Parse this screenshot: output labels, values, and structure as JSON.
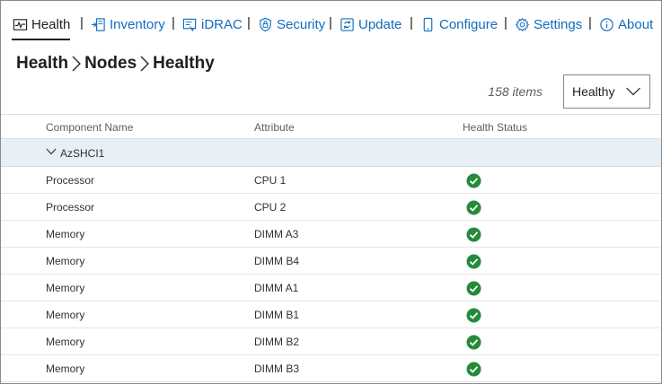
{
  "tabs": [
    {
      "label": "Health",
      "icon": "health-monitor-icon",
      "active": true
    },
    {
      "label": "Inventory",
      "icon": "inventory-icon"
    },
    {
      "label": "iDRAC",
      "icon": "idrac-icon"
    },
    {
      "label": "Security",
      "icon": "shield-icon"
    },
    {
      "label": "Update",
      "icon": "update-icon"
    },
    {
      "label": "Configure",
      "icon": "phone-configure-icon"
    },
    {
      "label": "Settings",
      "icon": "gear-icon"
    },
    {
      "label": "About",
      "icon": "info-icon"
    }
  ],
  "tab_separator": "|",
  "breadcrumb": [
    "Health",
    "Nodes",
    "Healthy"
  ],
  "item_count": "158 items",
  "filter": {
    "selected": "Healthy"
  },
  "table": {
    "headers": [
      "Component Name",
      "Attribute",
      "Health Status"
    ],
    "group": {
      "label": "AzSHCI1"
    },
    "rows": [
      {
        "component": "Processor",
        "attribute": "CPU 1",
        "status": "healthy"
      },
      {
        "component": "Processor",
        "attribute": "CPU 2",
        "status": "healthy"
      },
      {
        "component": "Memory",
        "attribute": "DIMM A3",
        "status": "healthy"
      },
      {
        "component": "Memory",
        "attribute": "DIMM B4",
        "status": "healthy"
      },
      {
        "component": "Memory",
        "attribute": "DIMM A1",
        "status": "healthy"
      },
      {
        "component": "Memory",
        "attribute": "DIMM B1",
        "status": "healthy"
      },
      {
        "component": "Memory",
        "attribute": "DIMM B2",
        "status": "healthy"
      },
      {
        "component": "Memory",
        "attribute": "DIMM B3",
        "status": "healthy"
      }
    ]
  },
  "colors": {
    "link": "#0f6cbd",
    "healthy": "#258a3a",
    "group_bg": "#e8eff6"
  }
}
